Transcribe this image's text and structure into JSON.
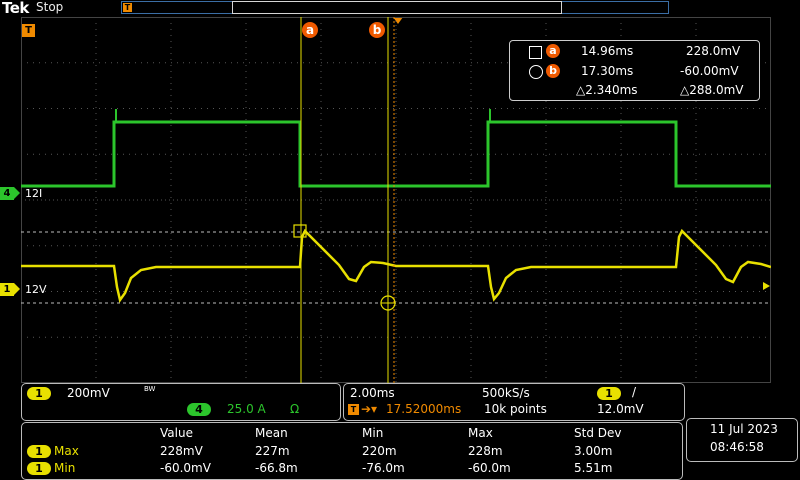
{
  "header": {
    "brand": "Tek",
    "run_state": "Stop",
    "trigger_tag": "T"
  },
  "colors": {
    "ch1": "#e8e000",
    "ch4": "#2cc52c",
    "trigger": "#f08a00",
    "cursor_badge": "#f05a00",
    "grid": "#555555"
  },
  "channels": {
    "ch4": {
      "tag": "4",
      "offset_label": "12I"
    },
    "ch1": {
      "tag": "1",
      "offset_label": "12V"
    }
  },
  "cursors": {
    "a_label": "a",
    "b_label": "b",
    "readout": {
      "a_time": "14.96ms",
      "a_value": "228.0mV",
      "b_time": "17.30ms",
      "b_value": "-60.00mV",
      "delta_time": "△2.340ms",
      "delta_value": "△288.0mV"
    }
  },
  "vertical_panel": {
    "ch1_tag": "1",
    "ch1_scale": "200mV",
    "bw_icon": "BW",
    "ch4_tag": "4",
    "ch4_scale": "25.0 A",
    "ch4_unit": "Ω"
  },
  "horizontal_panel": {
    "time_div": "2.00ms",
    "sample_rate": "500kS/s",
    "trig_source": "1",
    "trig_slope": "/",
    "trig_pos_tag": "T",
    "trig_position": "17.52000ms",
    "record_length": "10k points",
    "trig_level": "12.0mV"
  },
  "measurements": {
    "headers": [
      "Value",
      "Mean",
      "Min",
      "Max",
      "Std Dev"
    ],
    "rows": [
      {
        "ch": "1",
        "name": "Max",
        "values": [
          "228mV",
          "227m",
          "220m",
          "228m",
          "3.00m"
        ]
      },
      {
        "ch": "1",
        "name": "Min",
        "values": [
          "-60.0mV",
          "-66.8m",
          "-76.0m",
          "-60.0m",
          "5.51m"
        ]
      }
    ]
  },
  "datetime": {
    "date": "11 Jul  2023",
    "time": "08:46:58"
  }
}
